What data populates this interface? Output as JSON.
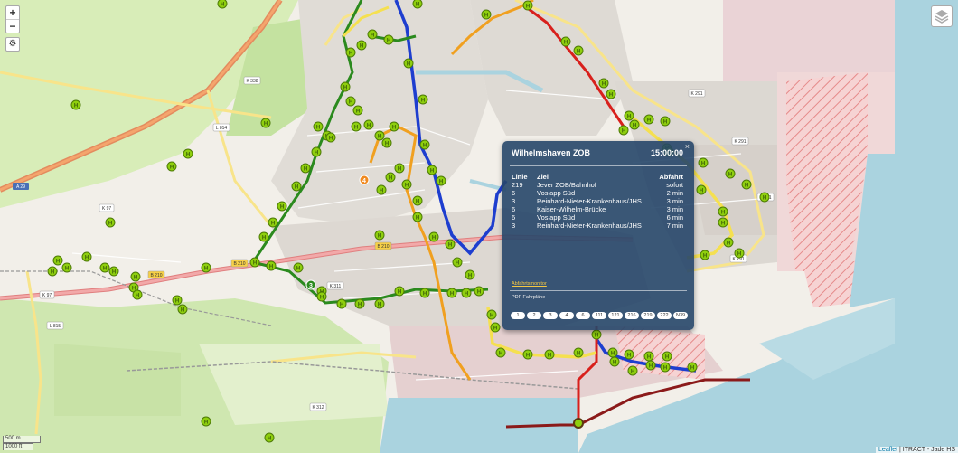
{
  "map": {
    "controls": {
      "zoom_in": "+",
      "zoom_out": "−"
    },
    "scale": {
      "metric": "500 m",
      "imperial": "1000 ft"
    },
    "attribution": {
      "leaflet": "Leaflet",
      "rest": "| ITRACT - Jade HS"
    },
    "route_numbers": {
      "route4": "4",
      "route3": "3"
    },
    "road_labels": [
      "A 29",
      "L 814",
      "K 338",
      "K 97",
      "K 97",
      "L 815",
      "B 210",
      "B 210",
      "B 210",
      "K 311",
      "K 312",
      "K 291",
      "K 291",
      "K 291",
      "K 291"
    ],
    "colors": {
      "water": "#aad3df",
      "land": "#f2efe9",
      "stop": "#8fcf0e",
      "blue_line": "#1e3ecf",
      "green_line": "#2b8a1e",
      "orange_line": "#f0a020",
      "red_line": "#d8201c",
      "yellow_line": "#f5e050",
      "darkred_line": "#8b1a1a"
    }
  },
  "popup": {
    "stop_name": "Wilhelmshaven ZOB",
    "time": "15:00:00",
    "close": "×",
    "headers": {
      "line": "Linie",
      "destination": "Ziel",
      "departure": "Abfahrt"
    },
    "departures": [
      {
        "line": "219",
        "destination": "Jever ZOB/Bahnhof",
        "departure": "sofort"
      },
      {
        "line": "6",
        "destination": "Voslapp Süd",
        "departure": "2 min"
      },
      {
        "line": "3",
        "destination": "Reinhard-Nieter-Krankenhaus/JHS",
        "departure": "3 min"
      },
      {
        "line": "6",
        "destination": "Kaiser-Wilhelm-Brücke",
        "departure": "3 min"
      },
      {
        "line": "6",
        "destination": "Voslapp Süd",
        "departure": "6 min"
      },
      {
        "line": "3",
        "destination": "Reinhard-Nieter-Krankenhaus/JHS",
        "departure": "7 min"
      }
    ],
    "monitor_link": "Abfahrtsmonitor",
    "pdf_label": "PDF Fahrpläne",
    "pdf_lines": [
      "1",
      "2",
      "3",
      "4",
      "6",
      "111",
      "121",
      "216",
      "219",
      "222",
      "N39"
    ]
  }
}
